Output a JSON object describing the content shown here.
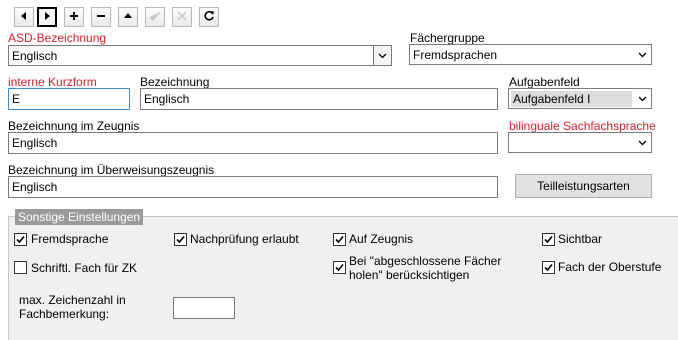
{
  "toolbar": {
    "buttons": [
      {
        "name": "previous-record-button",
        "icon": "triangle-left-icon"
      },
      {
        "name": "next-record-button",
        "icon": "triangle-right-icon"
      },
      {
        "name": "add-record-button",
        "icon": "plus-icon"
      },
      {
        "name": "delete-record-button",
        "icon": "minus-icon"
      },
      {
        "name": "move-up-button",
        "icon": "triangle-up-icon"
      },
      {
        "name": "confirm-button",
        "icon": "checkmark-icon"
      },
      {
        "name": "cancel-button",
        "icon": "x-icon"
      },
      {
        "name": "refresh-button",
        "icon": "refresh-icon"
      }
    ]
  },
  "form": {
    "asd_label": "ASD-Bezeichnung",
    "asd_value": "Englisch",
    "faechergruppe_label": "Fächergruppe",
    "faechergruppe_value": "Fremdsprachen",
    "kurzform_label": "interne Kurzform",
    "kurzform_value": "E",
    "bezeichnung_label": "Bezeichnung",
    "bezeichnung_value": "Englisch",
    "aufgabenfeld_label": "Aufgabenfeld",
    "aufgabenfeld_value": "Aufgabenfeld I",
    "zeugnis_label": "Bezeichnung im Zeugnis",
    "zeugnis_value": "Englisch",
    "bilingual_label": "bilinguale Sachfachsprache",
    "bilingual_value": "",
    "ueberweisung_label": "Bezeichnung im Überweisungszeugnis",
    "ueberweisung_value": "Englisch",
    "teilleistung_button": "Teilleistungsarten"
  },
  "settings": {
    "title": "Sonstige Einstellungen",
    "fremdsprache": {
      "label": "Fremdsprache",
      "checked": true
    },
    "nachpruefung": {
      "label": "Nachprüfung erlaubt",
      "checked": true
    },
    "auf_zeugnis": {
      "label": "Auf Zeugnis",
      "checked": true
    },
    "sichtbar": {
      "label": "Sichtbar",
      "checked": true
    },
    "schriftl_fach": {
      "label": "Schriftl. Fach für ZK",
      "checked": false
    },
    "abgeschlossene": {
      "label_line1": "Bei \"abgeschlossene Fächer",
      "label_line2": "holen\" berücksichtigen",
      "checked": true
    },
    "oberstufe": {
      "label": "Fach der Oberstufe",
      "checked": true
    },
    "zeichenzahl_line1": "max. Zeichenzahl in",
    "zeichenzahl_line2": "Fachbemerkung:",
    "zeichenzahl_value": ""
  },
  "colors": {
    "required_label": "#d8202a",
    "focus_border": "#3c8fd0",
    "group_bg": "#f0f0f0"
  }
}
